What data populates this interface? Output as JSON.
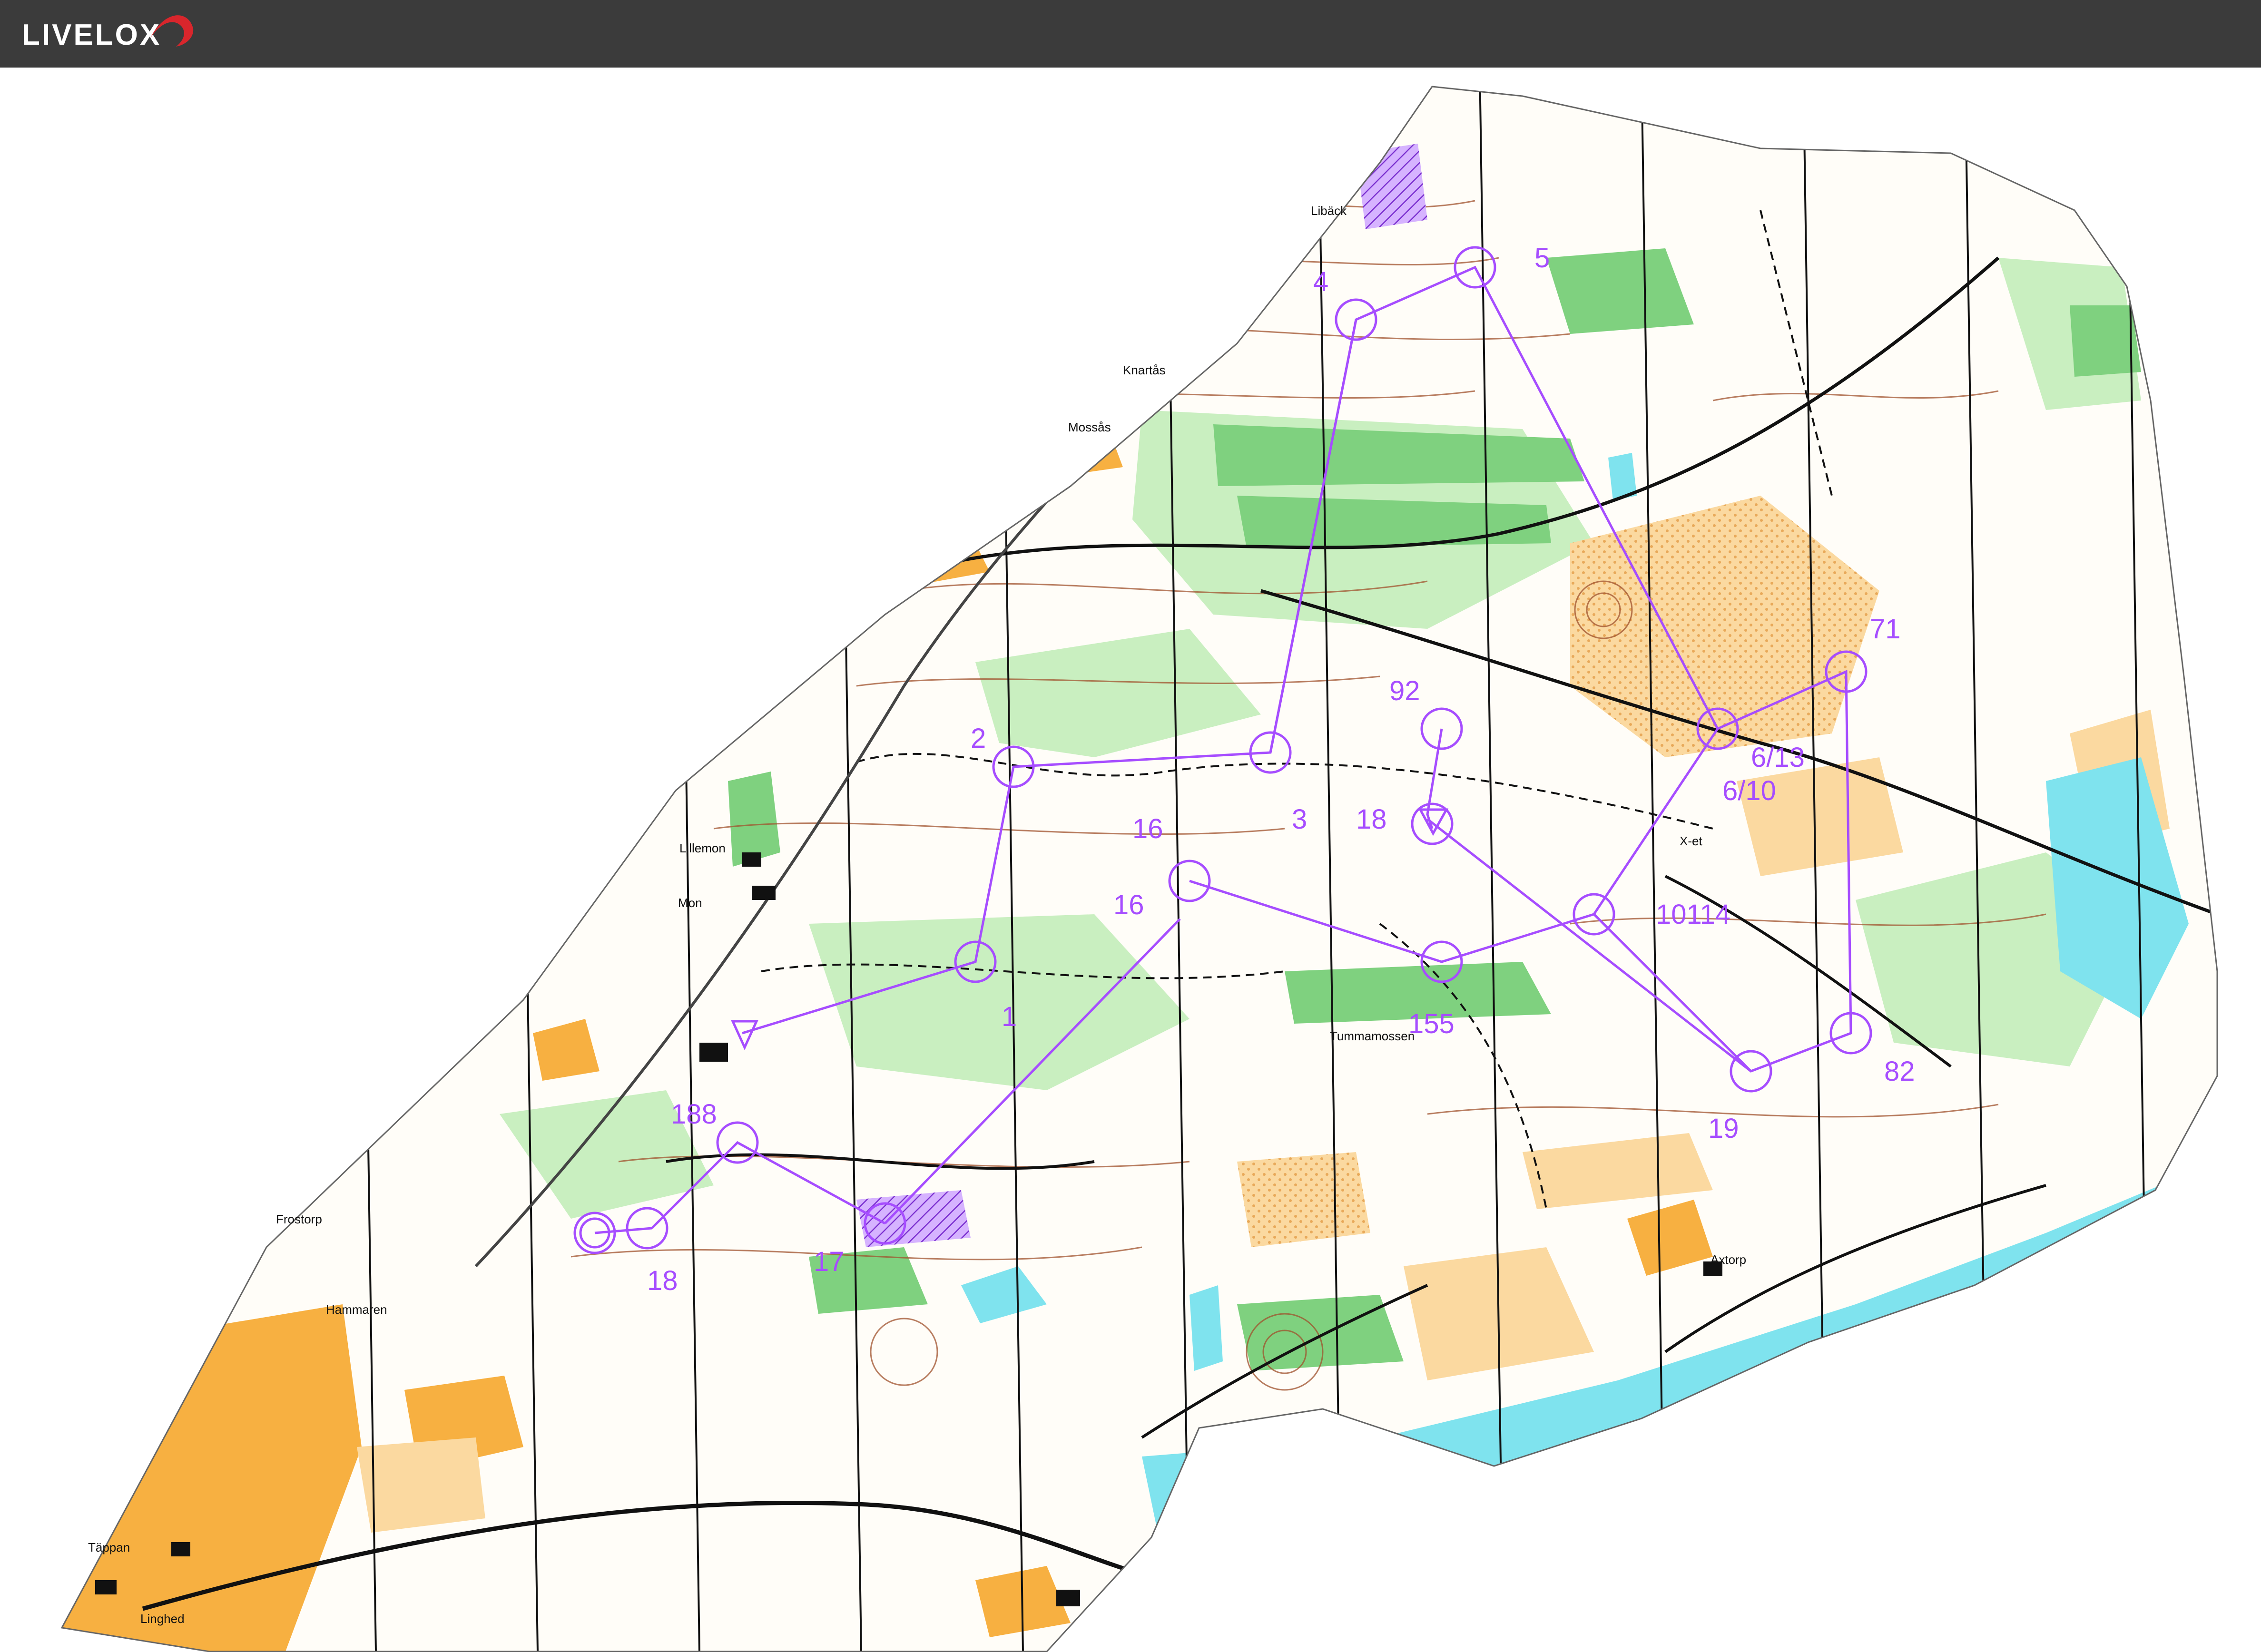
{
  "app": {
    "brand": "LIVELOX"
  },
  "colors": {
    "topbar": "#3b3b3b",
    "brand_text": "#ffffff",
    "brand_accent": "#d9262c",
    "course": "#a64dff",
    "forest_green": "#8fd68f",
    "light_green": "#c9efc0",
    "open_yellow": "#f7b041",
    "rough_open": "#fbd9a0",
    "water": "#7fe3ee",
    "contour": "#a0522d",
    "road": "#111111"
  },
  "place_names": [
    {
      "id": "liback",
      "text": "Libäck"
    },
    {
      "id": "knartas",
      "text": "Knartås"
    },
    {
      "id": "mossas",
      "text": "Mossås"
    },
    {
      "id": "lillemon",
      "text": "Lillemon"
    },
    {
      "id": "mon",
      "text": "Mon"
    },
    {
      "id": "tummamossen",
      "text": "Tummamossen"
    },
    {
      "id": "xet",
      "text": "X-et"
    },
    {
      "id": "frostorp",
      "text": "Frostorp"
    },
    {
      "id": "hammaren",
      "text": "Hammaren"
    },
    {
      "id": "axtorp",
      "text": "Axtorp"
    },
    {
      "id": "tappan",
      "text": "Täppan"
    },
    {
      "id": "linghed",
      "text": "Linghed"
    }
  ],
  "course_labels": [
    {
      "id": "c1",
      "text": "1"
    },
    {
      "id": "c2",
      "text": "2"
    },
    {
      "id": "c3",
      "text": "3"
    },
    {
      "id": "c4",
      "text": "4"
    },
    {
      "id": "c5",
      "text": "5"
    },
    {
      "id": "c613",
      "text": "6/13"
    },
    {
      "id": "c610",
      "text": "6/10"
    },
    {
      "id": "c71",
      "text": "71"
    },
    {
      "id": "c92",
      "text": "92"
    },
    {
      "id": "c82",
      "text": "82"
    },
    {
      "id": "c18a",
      "text": "18"
    },
    {
      "id": "c1014",
      "text": "10114"
    },
    {
      "id": "c16a",
      "text": "16"
    },
    {
      "id": "c16b",
      "text": "16"
    },
    {
      "id": "c155",
      "text": "155"
    },
    {
      "id": "c19",
      "text": "19"
    },
    {
      "id": "c188",
      "text": "188"
    },
    {
      "id": "c17",
      "text": "17"
    },
    {
      "id": "c18b",
      "text": "18"
    }
  ]
}
